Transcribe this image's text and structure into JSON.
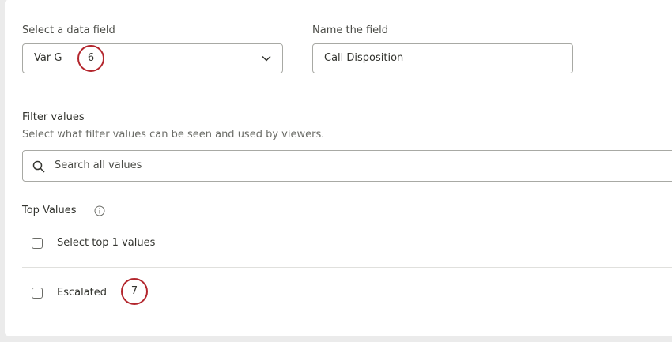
{
  "data_field": {
    "label": "Select a data field",
    "selected_value": "Var G",
    "callout": "6"
  },
  "name_field": {
    "label": "Name the field",
    "value": "Call Disposition"
  },
  "filter_values": {
    "title": "Filter values",
    "description": "Select what filter values can be seen and used by viewers.",
    "search_placeholder": "Search all values"
  },
  "top_values": {
    "title": "Top Values",
    "items": [
      {
        "label": "Select top 1 values",
        "checked": false
      },
      {
        "label": "Escalated",
        "checked": false,
        "callout": "7"
      }
    ]
  },
  "colors": {
    "callout_border": "#b3262d",
    "border": "#a8a9a4"
  },
  "icons": [
    "chevron-down-icon",
    "search-icon",
    "info-icon"
  ]
}
